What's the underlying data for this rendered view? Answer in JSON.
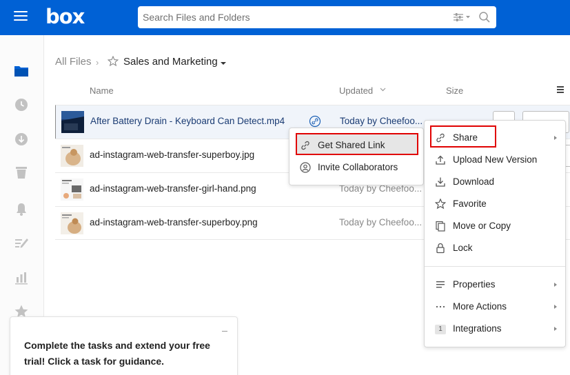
{
  "header": {
    "logo": "box",
    "search_placeholder": "Search Files and Folders"
  },
  "breadcrumb": {
    "root": "All Files",
    "current": "Sales and Marketing"
  },
  "columns": {
    "name": "Name",
    "updated": "Updated",
    "size": "Size"
  },
  "files": [
    {
      "name": "After Battery Drain - Keyboard Can Detect.mp4",
      "updated": "Today by Cheefoo..."
    },
    {
      "name": "ad-instagram-web-transfer-superboy.jpg",
      "updated": ""
    },
    {
      "name": "ad-instagram-web-transfer-girl-hand.png",
      "updated": "Today by Cheefoo..."
    },
    {
      "name": "ad-instagram-web-transfer-superboy.png",
      "updated": "Today by Cheefoo..."
    }
  ],
  "context_menu": {
    "items": [
      {
        "label": "Share",
        "icon": "link-icon"
      },
      {
        "label": "Upload New Version",
        "icon": "upload-icon"
      },
      {
        "label": "Download",
        "icon": "download-icon"
      },
      {
        "label": "Favorite",
        "icon": "star-icon"
      },
      {
        "label": "Move or Copy",
        "icon": "copy-icon"
      },
      {
        "label": "Lock",
        "icon": "lock-icon"
      },
      {
        "label": "Properties",
        "icon": "properties-icon"
      },
      {
        "label": "More Actions",
        "icon": "more-icon"
      },
      {
        "label": "Integrations",
        "icon": "integrations-icon",
        "badge": "1"
      }
    ]
  },
  "share_submenu": {
    "items": [
      {
        "label": "Get Shared Link",
        "icon": "link-icon"
      },
      {
        "label": "Invite Collaborators",
        "icon": "collaborators-icon"
      }
    ]
  },
  "guide_card": {
    "text": "Complete the tasks and extend your free trial! Click a task for guidance."
  },
  "colors": {
    "brand": "#0061d5",
    "highlight_border": "#e00000"
  }
}
